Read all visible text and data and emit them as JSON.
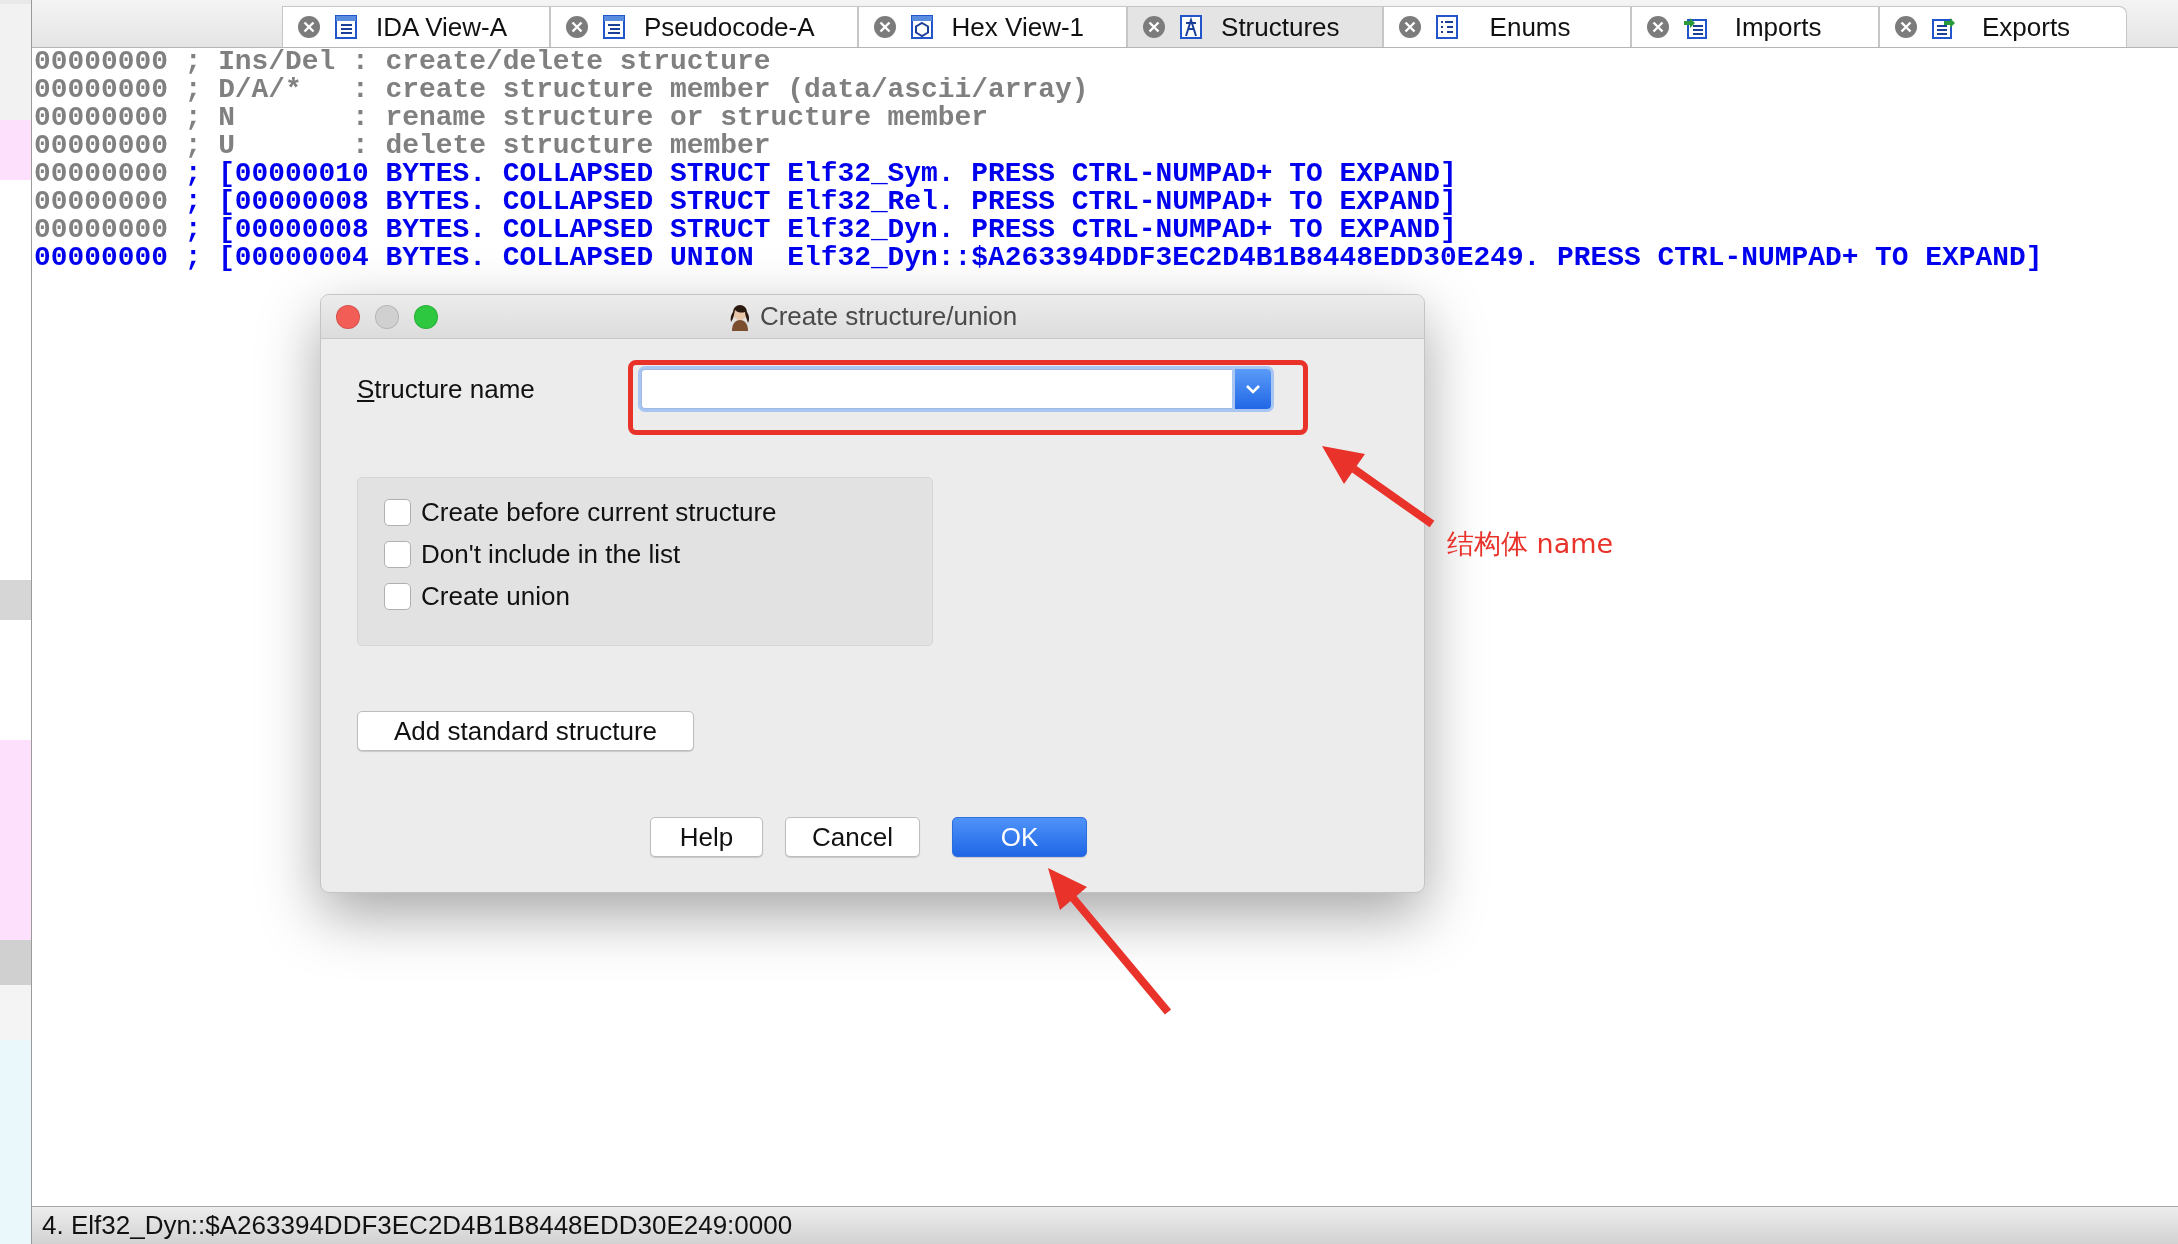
{
  "tabs": [
    {
      "label": "IDA View-A",
      "selected": false
    },
    {
      "label": "Pseudocode-A",
      "selected": false
    },
    {
      "label": "Hex View-1",
      "selected": false
    },
    {
      "label": "Structures",
      "selected": true
    },
    {
      "label": "Enums",
      "selected": false
    },
    {
      "label": "Imports",
      "selected": false
    },
    {
      "label": "Exports",
      "selected": false
    }
  ],
  "code_lines": [
    {
      "address": "00000000",
      "text": "; Ins/Del : create/delete structure",
      "kind": "comment",
      "current": false
    },
    {
      "address": "00000000",
      "text": "; D/A/*   : create structure member (data/ascii/array)",
      "kind": "comment",
      "current": false
    },
    {
      "address": "00000000",
      "text": "; N       : rename structure or structure member",
      "kind": "comment",
      "current": false
    },
    {
      "address": "00000000",
      "text": "; U       : delete structure member",
      "kind": "comment",
      "current": false
    },
    {
      "address": "00000000",
      "text": "; [00000010 BYTES. COLLAPSED STRUCT Elf32_Sym. PRESS CTRL-NUMPAD+ TO EXPAND]",
      "kind": "collapsed",
      "current": false
    },
    {
      "address": "00000000",
      "text": "; [00000008 BYTES. COLLAPSED STRUCT Elf32_Rel. PRESS CTRL-NUMPAD+ TO EXPAND]",
      "kind": "collapsed",
      "current": false
    },
    {
      "address": "00000000",
      "text": "; [00000008 BYTES. COLLAPSED STRUCT Elf32_Dyn. PRESS CTRL-NUMPAD+ TO EXPAND]",
      "kind": "collapsed",
      "current": false
    },
    {
      "address": "00000000",
      "text": "; [00000004 BYTES. COLLAPSED UNION  Elf32_Dyn::$A263394DDF3EC2D4B1B8448EDD30E249. PRESS CTRL-NUMPAD+ TO EXPAND]",
      "kind": "collapsed",
      "current": true
    }
  ],
  "dialog": {
    "title": "Create structure/union",
    "field_label": "Structure name",
    "options": [
      {
        "label": "Create before current structure",
        "checked": false
      },
      {
        "label": "Don't include in the list",
        "checked": false
      },
      {
        "label": "Create union",
        "checked": false
      }
    ],
    "extra_button": "Add standard structure",
    "buttons": [
      {
        "label": "Help",
        "default": false
      },
      {
        "label": "Cancel",
        "default": false
      },
      {
        "label": "OK",
        "default": true
      }
    ]
  },
  "annotation": {
    "label": "结构体 name"
  },
  "status_bar": {
    "text": "4. Elf32_Dyn::$A263394DDF3EC2D4B1B8448EDD30E249:0000"
  }
}
